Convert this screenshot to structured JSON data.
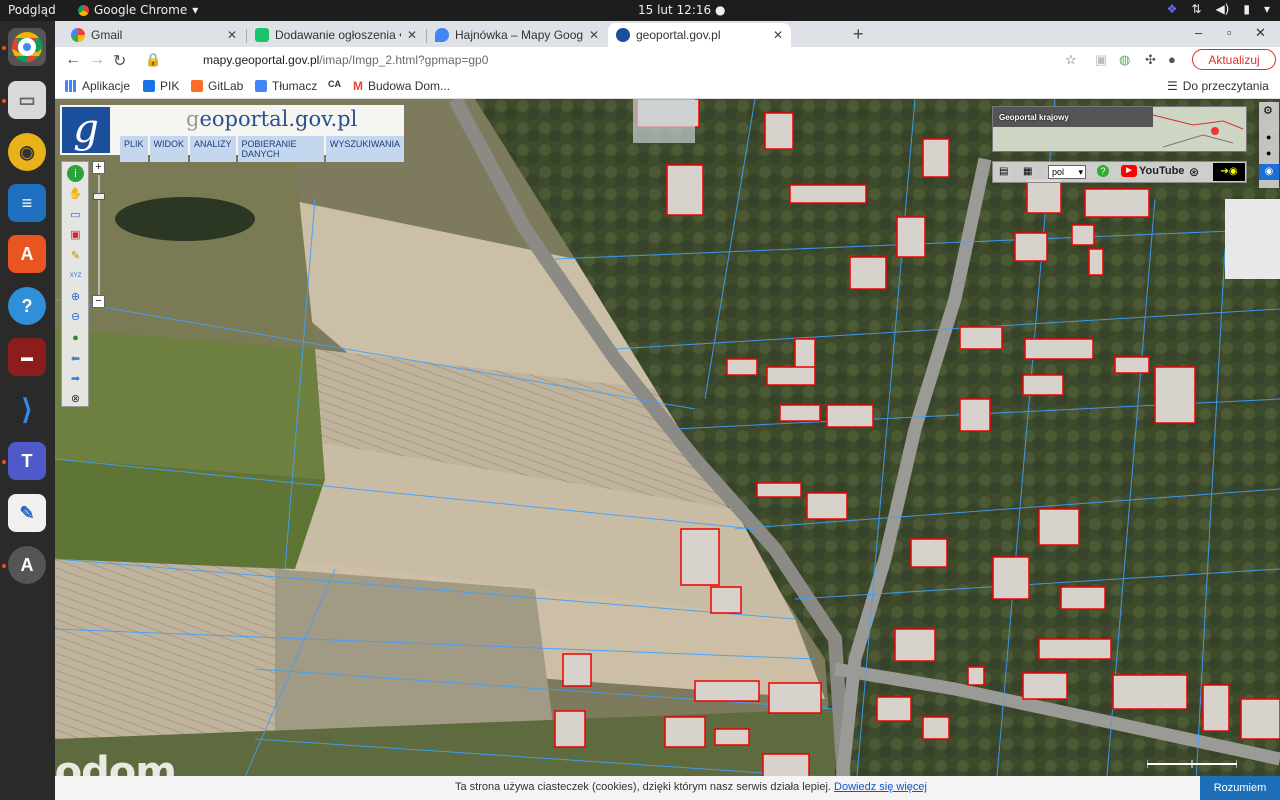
{
  "topbar": {
    "activities": "Podgląd",
    "app_name": "Google Chrome",
    "clock": "15 lut  12:16"
  },
  "tabs": [
    {
      "title": "Gmail",
      "favicon_color": "#ffffff",
      "favicon": "google-g-icon"
    },
    {
      "title": "Dodawanie ogłoszenia • …",
      "favicon_color": "#18c46c",
      "favicon": "otodom-icon"
    },
    {
      "title": "Hajnówka – Mapy Google",
      "favicon_color": "#4285f4",
      "favicon": "maps-pin-icon"
    },
    {
      "title": "geoportal.gov.pl",
      "favicon_color": "#1b4f9c",
      "favicon": "geoportal-icon"
    }
  ],
  "omnibox": {
    "host": "mapy.geoportal.gov.pl",
    "path": "/imap/Imgp_2.html?gpmap=gp0",
    "update_label": "Aktualizuj"
  },
  "bookmarks": {
    "items": [
      {
        "label": "Aplikacje",
        "color": "#4285f4"
      },
      {
        "label": "PIK",
        "color": "#1a73e8"
      },
      {
        "label": "GitLab",
        "color": "#fc6d26"
      },
      {
        "label": "Tłumacz",
        "color": "#4285f4"
      },
      {
        "label": "",
        "color": "#333333"
      },
      {
        "label": "Budowa Dom...",
        "color": "#ea4335"
      }
    ],
    "reading_list": "Do przeczytania"
  },
  "geoportal": {
    "title_g": "g",
    "title_rest": "eoportal.gov.pl",
    "logo_letter": "g",
    "menu": [
      "PLIK",
      "WIDOK",
      "ANALIZY",
      "POBIERANIE DANYCH",
      "WYSZUKIWANIA"
    ],
    "overview_label": "Geoportal krajowy",
    "lang": "pol",
    "youtube": "YouTube",
    "zoom_in": "+",
    "zoom_out": "−"
  },
  "cookie": {
    "text": "Ta strona używa ciasteczek (cookies), dzięki którym nasz serwis działa lepiej.",
    "link": "Dowiedz się więcej",
    "button": "Rozumiem"
  },
  "watermark": "otodom"
}
